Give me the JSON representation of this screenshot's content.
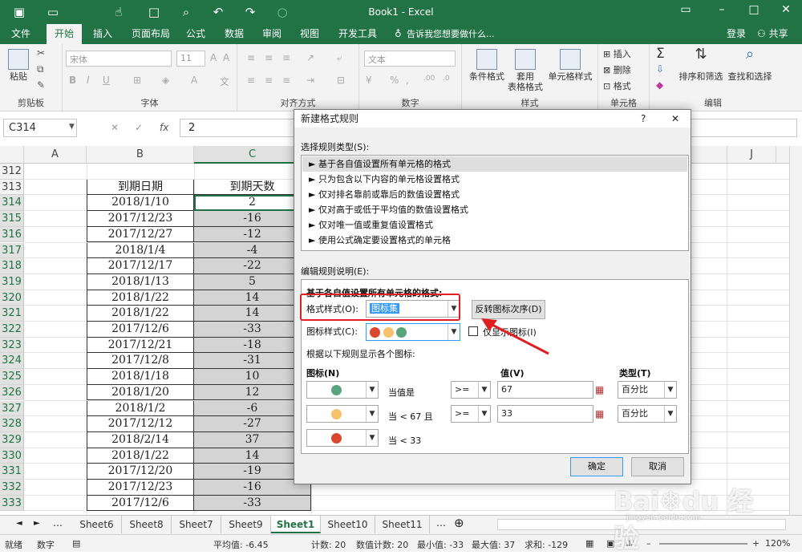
{
  "window": {
    "title": "Book1 - Excel",
    "login": "登录",
    "share": "共享"
  },
  "ribbon_tabs": [
    "文件",
    "开始",
    "插入",
    "页面布局",
    "公式",
    "数据",
    "审阅",
    "视图",
    "开发工具"
  ],
  "active_tab": "开始",
  "tell_me": "告诉我您想要做什么...",
  "ribbon": {
    "paste": "粘贴",
    "font_name": "宋体",
    "font_size": "11",
    "number_format": "文本",
    "cond_format": "条件格式",
    "table_format_1": "套用",
    "table_format_2": "表格格式",
    "cell_style": "单元格样式",
    "insert": "插入",
    "delete": "删除",
    "format": "格式",
    "sort_filter": "排序和筛选",
    "find_select": "查找和选择",
    "groups": {
      "clipboard": "剪贴板",
      "font": "字体",
      "align": "对齐方式",
      "number": "数字",
      "style": "样式",
      "cells": "单元格",
      "edit": "编辑"
    }
  },
  "formula_bar": {
    "name_box": "C314",
    "fx": "fx",
    "value": "2"
  },
  "columns": [
    "A",
    "B",
    "C",
    "J"
  ],
  "table": {
    "header_b": "到期日期",
    "header_c": "到期天数",
    "rows": [
      {
        "r": "312",
        "b": "",
        "c": ""
      },
      {
        "r": "313",
        "b": "到期日期",
        "c": "到期天数"
      },
      {
        "r": "314",
        "b": "2018/1/10",
        "c": "2"
      },
      {
        "r": "315",
        "b": "2017/12/23",
        "c": "-16"
      },
      {
        "r": "316",
        "b": "2017/12/27",
        "c": "-12"
      },
      {
        "r": "317",
        "b": "2018/1/4",
        "c": "-4"
      },
      {
        "r": "318",
        "b": "2017/12/17",
        "c": "-22"
      },
      {
        "r": "319",
        "b": "2018/1/13",
        "c": "5"
      },
      {
        "r": "320",
        "b": "2018/1/22",
        "c": "14"
      },
      {
        "r": "321",
        "b": "2018/1/22",
        "c": "14"
      },
      {
        "r": "322",
        "b": "2017/12/6",
        "c": "-33"
      },
      {
        "r": "323",
        "b": "2017/12/21",
        "c": "-18"
      },
      {
        "r": "324",
        "b": "2017/12/8",
        "c": "-31"
      },
      {
        "r": "325",
        "b": "2018/1/18",
        "c": "10"
      },
      {
        "r": "326",
        "b": "2018/1/20",
        "c": "12"
      },
      {
        "r": "327",
        "b": "2018/1/2",
        "c": "-6"
      },
      {
        "r": "328",
        "b": "2017/12/12",
        "c": "-27"
      },
      {
        "r": "329",
        "b": "2018/2/14",
        "c": "37"
      },
      {
        "r": "330",
        "b": "2018/1/22",
        "c": "14"
      },
      {
        "r": "331",
        "b": "2017/12/20",
        "c": "-19"
      },
      {
        "r": "332",
        "b": "2017/12/23",
        "c": "-16"
      },
      {
        "r": "333",
        "b": "2017/12/6",
        "c": "-33"
      }
    ]
  },
  "sheets": [
    "Sheet6",
    "Sheet8",
    "Sheet7",
    "Sheet9",
    "Sheet1",
    "Sheet10",
    "Sheet11"
  ],
  "active_sheet": "Sheet1",
  "status": {
    "ready": "就绪",
    "num": "数字",
    "average": "平均值: -6.45",
    "count": "计数: 20",
    "num_count": "数值计数: 20",
    "min": "最小值: -33",
    "max": "最大值: 37",
    "sum": "求和: -129",
    "zoom": "120%"
  },
  "dialog": {
    "title": "新建格式规则",
    "help": "?",
    "select_type_label": "选择规则类型(S):",
    "rule_types": [
      "► 基于各自值设置所有单元格的格式",
      "► 只为包含以下内容的单元格设置格式",
      "► 仅对排名靠前或靠后的数值设置格式",
      "► 仅对高于或低于平均值的数值设置格式",
      "► 仅对唯一值或重复值设置格式",
      "► 使用公式确定要设置格式的单元格"
    ],
    "edit_desc_label": "编辑规则说明(E):",
    "desc_title": "基于各自值设置所有单元格的格式:",
    "format_style_label": "格式样式(O):",
    "format_style_value": "图标集",
    "reverse_button": "反转图标次序(D)",
    "icon_style_label": "图标样式(C):",
    "show_icon_only": "仅显示图标(I)",
    "rule_hint": "根据以下规则显示各个图标:",
    "col_icon": "图标(N)",
    "col_value": "值(V)",
    "col_type": "类型(T)",
    "icon_rows": [
      {
        "cond": "当值是",
        "op": ">=",
        "value": "67",
        "type": "百分比"
      },
      {
        "cond": "当 < 67 且",
        "op": ">=",
        "value": "33",
        "type": "百分比"
      },
      {
        "cond": "当 < 33",
        "op": "",
        "value": "",
        "type": ""
      }
    ],
    "ok": "确定",
    "cancel": "取消"
  },
  "colors": {
    "excel_green": "#217346",
    "icon_green": "#5aa47b",
    "icon_yellow": "#f5c26b",
    "icon_red": "#d9472e",
    "highlight": "#e02020"
  }
}
